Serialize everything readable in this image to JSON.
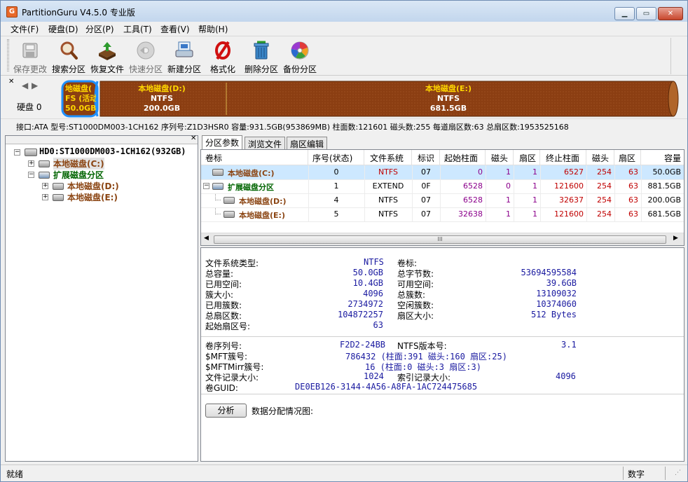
{
  "window": {
    "title": "PartitionGuru V4.5.0 专业版",
    "min_label": "▁",
    "max_label": "▭",
    "close_label": "✕"
  },
  "menu": [
    {
      "label": "文件(F)"
    },
    {
      "label": "硬盘(D)"
    },
    {
      "label": "分区(P)"
    },
    {
      "label": "工具(T)"
    },
    {
      "label": "查看(V)"
    },
    {
      "label": "帮助(H)"
    }
  ],
  "toolbar": [
    {
      "label": "保存更改",
      "icon": "save-icon",
      "enabled": false
    },
    {
      "label": "搜索分区",
      "icon": "search-icon",
      "enabled": true
    },
    {
      "label": "恢复文件",
      "icon": "recover-icon",
      "enabled": true
    },
    {
      "label": "快速分区",
      "icon": "quick-partition-icon",
      "enabled": false
    },
    {
      "label": "新建分区",
      "icon": "new-partition-icon",
      "enabled": true
    },
    {
      "label": "格式化",
      "icon": "format-icon",
      "enabled": true
    },
    {
      "label": "删除分区",
      "icon": "delete-icon",
      "enabled": true
    },
    {
      "label": "备份分区",
      "icon": "backup-icon",
      "enabled": true
    }
  ],
  "disk_map": {
    "disk_label": "硬盘 0",
    "partitions": [
      {
        "name": "地磁盘(",
        "fs": "FS (活动",
        "size": "50.0GB",
        "selected": true
      },
      {
        "name": "本地磁盘(D:)",
        "fs": "NTFS",
        "size": "200.0GB"
      },
      {
        "name": "本地磁盘(E:)",
        "fs": "NTFS",
        "size": "681.5GB"
      }
    ]
  },
  "disk_info": "接口:ATA  型号:ST1000DM003-1CH162  序列号:Z1D3HSR0  容量:931.5GB(953869MB)  柱面数:121601  磁头数:255  每道扇区数:63  总扇区数:1953525168",
  "tree": {
    "root": "HD0:ST1000DM003-1CH162(932GB)",
    "items": [
      {
        "label": "本地磁盘(C:)",
        "level": 1,
        "color": "#8b4513",
        "selected": true
      },
      {
        "label": "扩展磁盘分区",
        "level": 1,
        "color": "#006400"
      },
      {
        "label": "本地磁盘(D:)",
        "level": 2,
        "color": "#8b4513"
      },
      {
        "label": "本地磁盘(E:)",
        "level": 2,
        "color": "#8b4513"
      }
    ]
  },
  "tabs": [
    {
      "label": "分区参数"
    },
    {
      "label": "浏览文件"
    },
    {
      "label": "扇区编辑"
    }
  ],
  "table": {
    "columns": [
      "卷标",
      "序号(状态)",
      "文件系统",
      "标识",
      "起始柱面",
      "磁头",
      "扇区",
      "终止柱面",
      "磁头",
      "扇区",
      "容量"
    ],
    "rows": [
      {
        "cells": [
          "本地磁盘(C:)",
          "0",
          "NTFS",
          "07",
          "0",
          "1",
          "1",
          "6527",
          "254",
          "63",
          "50.0GB"
        ],
        "indent": 0,
        "color": "#8b4513"
      },
      {
        "cells": [
          "扩展磁盘分区",
          "1",
          "EXTEND",
          "0F",
          "6528",
          "0",
          "1",
          "121600",
          "254",
          "63",
          "881.5GB"
        ],
        "indent": 0,
        "color": "#006400"
      },
      {
        "cells": [
          "本地磁盘(D:)",
          "4",
          "NTFS",
          "07",
          "6528",
          "1",
          "1",
          "32637",
          "254",
          "63",
          "200.0GB"
        ],
        "indent": 1,
        "color": "#8b4513"
      },
      {
        "cells": [
          "本地磁盘(E:)",
          "5",
          "NTFS",
          "07",
          "32638",
          "1",
          "1",
          "121600",
          "254",
          "63",
          "681.5GB"
        ],
        "indent": 1,
        "color": "#8b4513"
      }
    ],
    "hscroll_grip": "III"
  },
  "details": {
    "fs_type_label": "文件系统类型:",
    "fs_type": "NTFS",
    "volume_label": "卷标:",
    "left": [
      {
        "k": "总容量:",
        "v": "50.0GB"
      },
      {
        "k": "已用空间:",
        "v": "10.4GB"
      },
      {
        "k": "簇大小:",
        "v": "4096"
      },
      {
        "k": "已用簇数:",
        "v": "2734972"
      },
      {
        "k": "总扇区数:",
        "v": "104872257"
      },
      {
        "k": "起始扇区号:",
        "v": "63"
      }
    ],
    "right": [
      {
        "k": "总字节数:",
        "v": "53694595584"
      },
      {
        "k": "可用空间:",
        "v": "39.6GB"
      },
      {
        "k": "总簇数:",
        "v": "13109032"
      },
      {
        "k": "空闲簇数:",
        "v": "10374060"
      },
      {
        "k": "扇区大小:",
        "v": "512 Bytes"
      }
    ],
    "serial_label": "卷序列号:",
    "serial": "F2D2-24BB",
    "ntfs_ver_label": "NTFS版本号:",
    "ntfs_ver": "3.1",
    "mft_label": "$MFT簇号:",
    "mft": "786432 (柱面:391 磁头:160 扇区:25)",
    "mftmirr_label": "$MFTMirr簇号:",
    "mftmirr": "16 (柱面:0 磁头:3 扇区:3)",
    "frs_label": "文件记录大小:",
    "frs": "1024",
    "idx_label": "索引记录大小:",
    "idx": "4096",
    "guid_label": "卷GUID:",
    "guid": "DE0EB126-3144-4A56-A8FA-1AC724475685",
    "analyze_button": "分析",
    "alloc_label": "数据分配情况图:"
  },
  "status": {
    "left": "就绪",
    "right": "数字"
  }
}
